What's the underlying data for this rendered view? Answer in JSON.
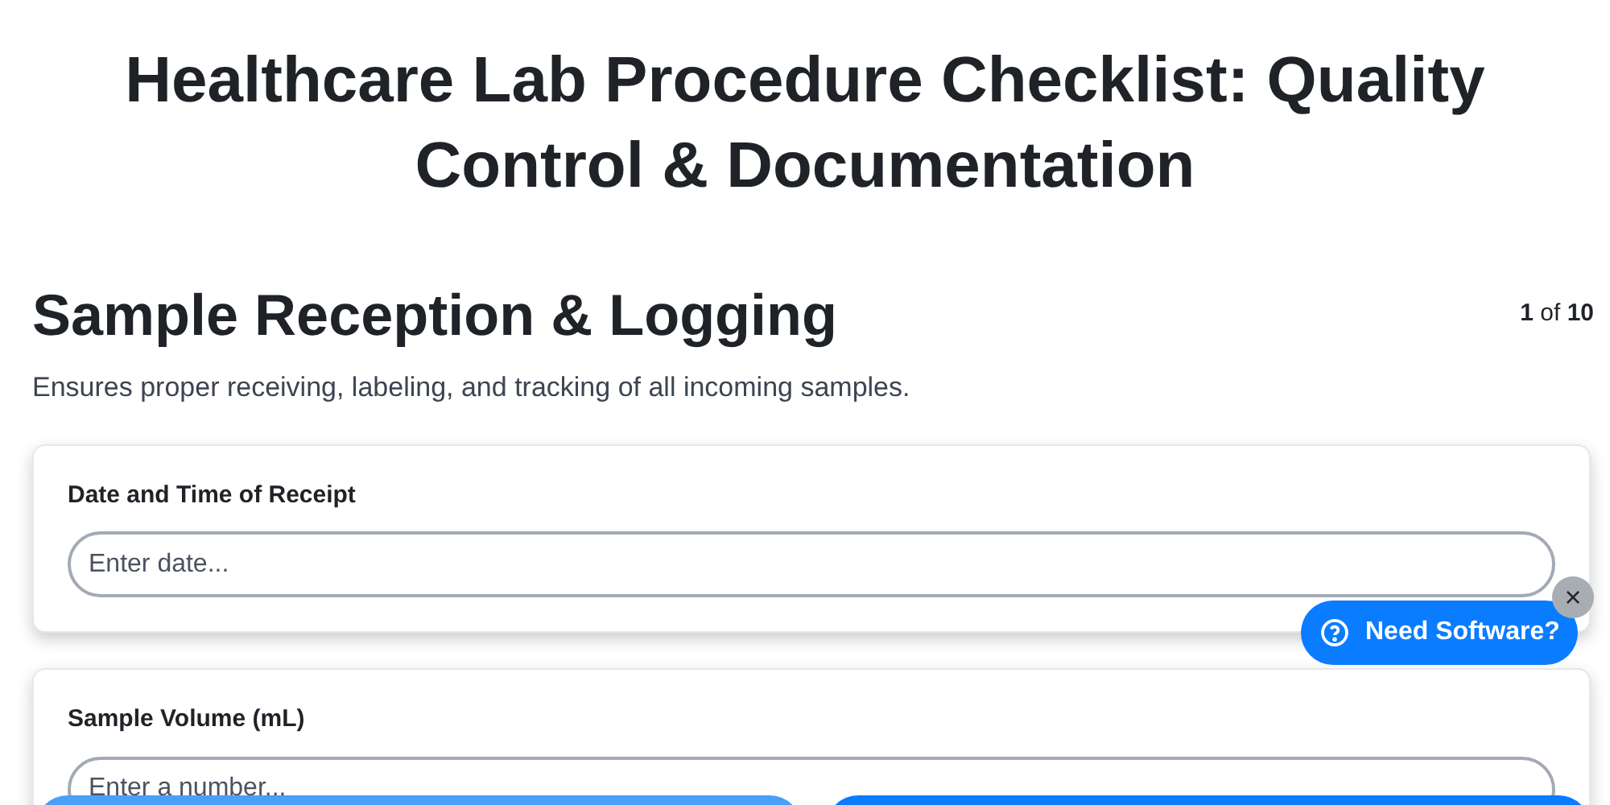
{
  "title": "Healthcare Lab Procedure Checklist: Quality Control & Documentation",
  "section": {
    "heading": "Sample Reception & Logging",
    "page_current": "1",
    "page_of": "of",
    "page_total": "10",
    "description": "Ensures proper receiving, labeling, and tracking of all incoming samples."
  },
  "fields": [
    {
      "label": "Date and Time of Receipt",
      "placeholder": "Enter date..."
    },
    {
      "label": "Sample Volume (mL)",
      "placeholder": "Enter a number..."
    }
  ],
  "help_popup": {
    "label": "Need Software?",
    "close": "×"
  },
  "bottom_buttons": [
    {
      "primary": false
    },
    {
      "primary": true
    }
  ]
}
